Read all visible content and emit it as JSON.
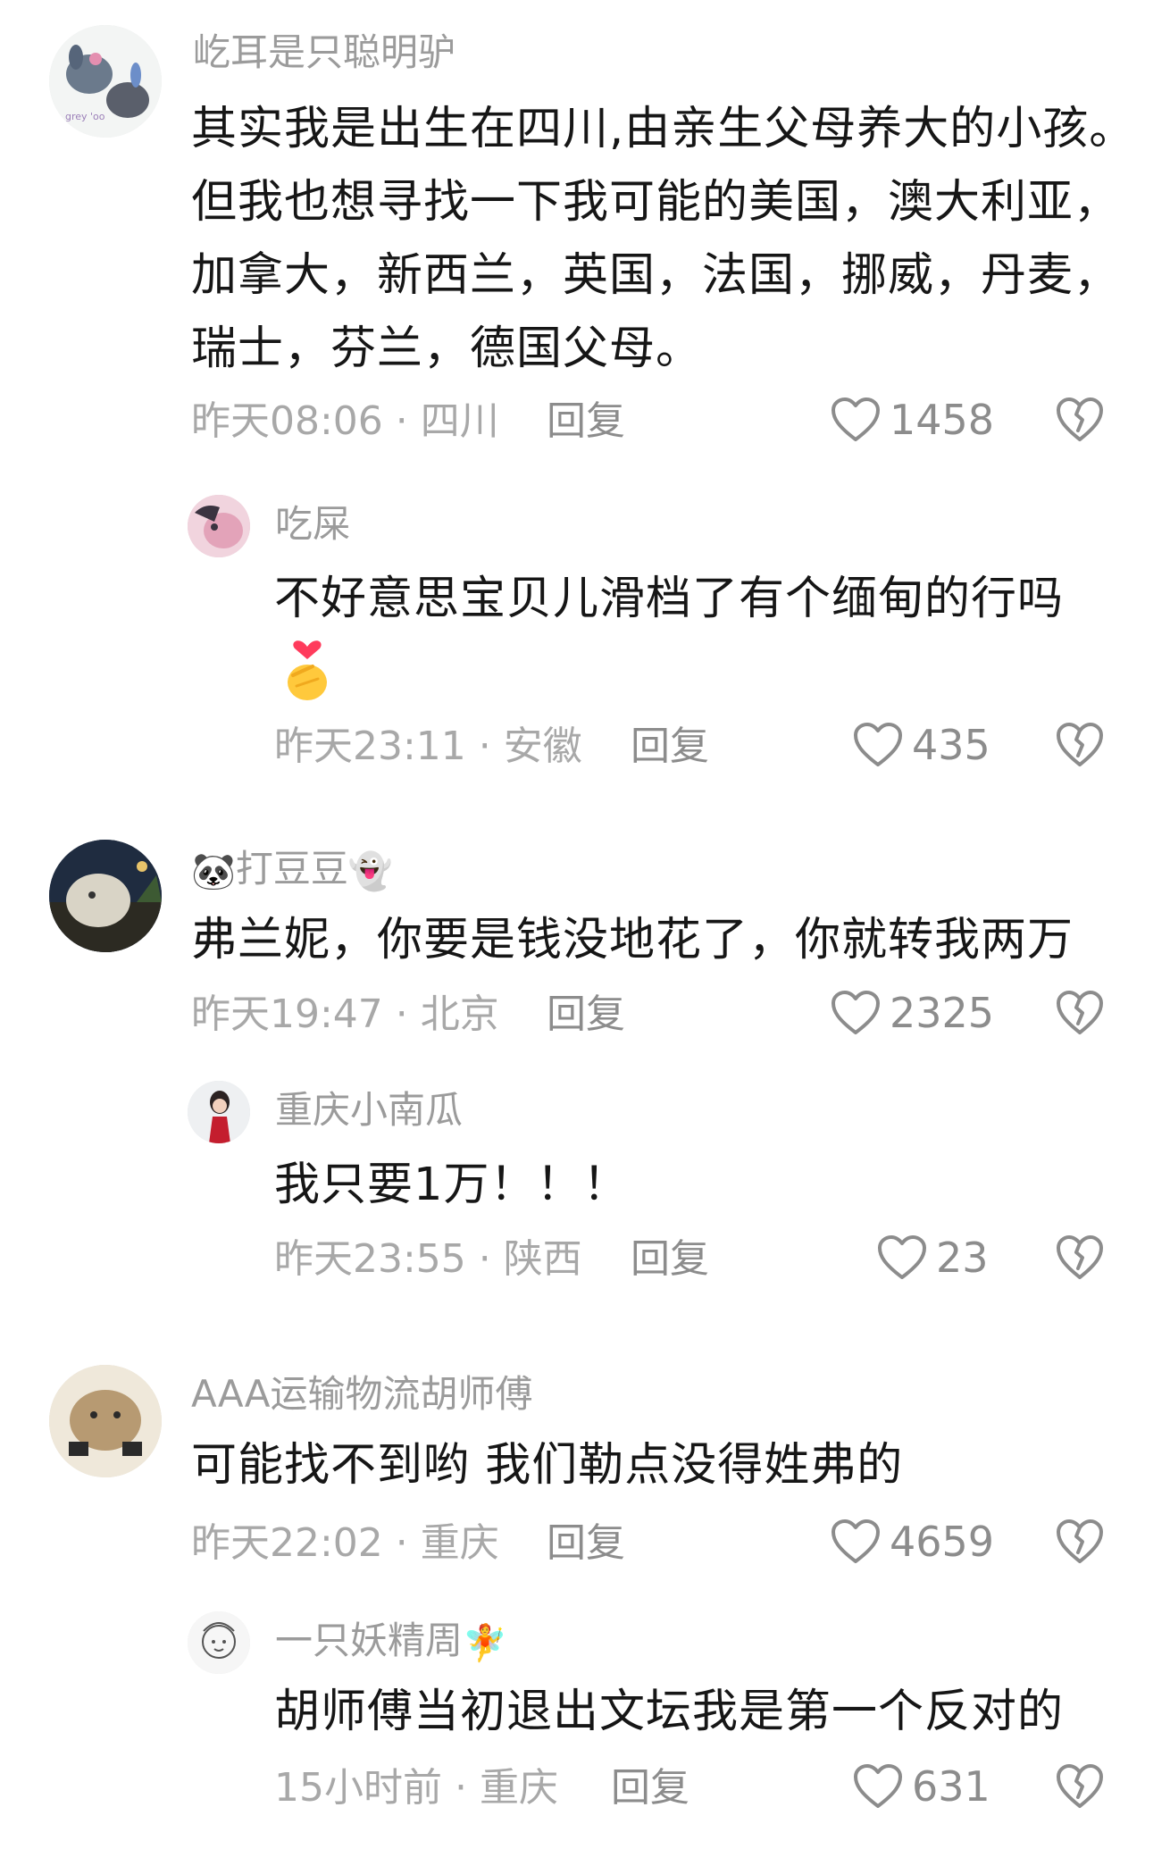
{
  "comments": [
    {
      "username": "屹耳是只聪明驴",
      "content": [
        "其实我是出生在四川,由亲生父母养大的小孩。",
        "但我也想寻找一下我可能的美国，澳大利亚，",
        "加拿大，新西兰，英国，法国，挪威，丹麦，",
        "瑞士，芬兰，德国父母。"
      ],
      "meta": "昨天08:06 · 四川",
      "reply_label": "回复",
      "likes": "1458",
      "replies": [
        {
          "username": "吃屎",
          "content": [
            "不好意思宝贝儿滑档了有个缅甸的行吗"
          ],
          "sticker": "finger-heart-emoji",
          "meta": "昨天23:11 · 安徽",
          "reply_label": "回复",
          "likes": "435"
        }
      ]
    },
    {
      "username": "打豆豆",
      "username_prefix_emoji": "🐼",
      "username_suffix_emoji": "👻",
      "content": [
        "弗兰妮，你要是钱没地花了，你就转我两万"
      ],
      "meta": "昨天19:47 · 北京",
      "reply_label": "回复",
      "likes": "2325",
      "replies": [
        {
          "username": "重庆小南瓜",
          "content": [
            "我只要1万！！！"
          ],
          "meta": "昨天23:55 · 陕西",
          "reply_label": "回复",
          "likes": "23"
        }
      ]
    },
    {
      "username": "AAA运输物流胡师傅",
      "content": [
        "可能找不到哟 我们勒点没得姓弗的"
      ],
      "meta": "昨天22:02 · 重庆",
      "reply_label": "回复",
      "likes": "4659",
      "replies": [
        {
          "username": "一只妖精周",
          "username_suffix_emoji": "🧚",
          "content": [
            "胡师傅当初退出文坛我是第一个反对的"
          ],
          "meta": "15小时前 · 重庆",
          "reply_label": "回复",
          "likes": "631"
        }
      ]
    }
  ],
  "colors": {
    "text": "#161616",
    "username": "#9b9b9b",
    "meta": "#a8a8a8",
    "icon": "#8c8c8c"
  }
}
